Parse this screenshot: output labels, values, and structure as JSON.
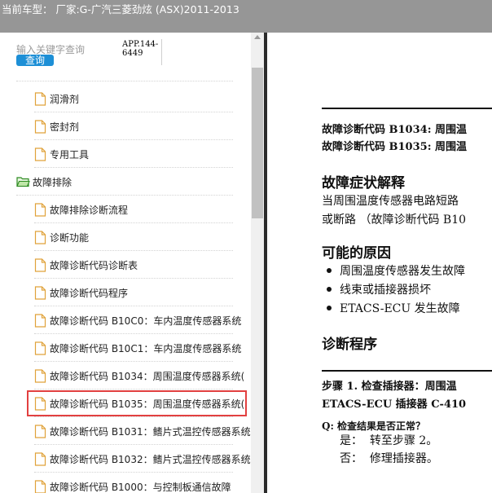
{
  "header": {
    "title": "当前车型： 厂家:G-广汽三菱劲炫 (ASX)2011-2013"
  },
  "search": {
    "placeholder": "输入关键字查询",
    "button_label": "查询",
    "app_code_line1": "APP.144-",
    "app_code_line2": "6449"
  },
  "tree": {
    "items": [
      {
        "label": "润滑剂",
        "icon": "document-icon"
      },
      {
        "label": "密封剂",
        "icon": "document-icon"
      },
      {
        "label": "专用工具",
        "icon": "document-icon"
      },
      {
        "label": "故障排除",
        "icon": "folder-open-icon"
      },
      {
        "label": "故障排除诊断流程",
        "icon": "document-icon"
      },
      {
        "label": "诊断功能",
        "icon": "document-icon"
      },
      {
        "label": "故障诊断代码诊断表",
        "icon": "document-icon"
      },
      {
        "label": "故障诊断代码程序",
        "icon": "document-icon"
      },
      {
        "label": "故障诊断代码 B10C0：车内温度传感器系统",
        "icon": "document-icon"
      },
      {
        "label": "故障诊断代码 B10C1：车内温度传感器系统",
        "icon": "document-icon"
      },
      {
        "label": "故障诊断代码 B1034：周围温度传感器系统(",
        "icon": "document-icon"
      },
      {
        "label": "故障诊断代码 B1035：周围温度传感器系统(",
        "icon": "document-icon",
        "selected": true
      },
      {
        "label": "故障诊断代码 B1031：鳍片式温控传感器系统",
        "icon": "document-icon"
      },
      {
        "label": "故障诊断代码 B1032：鳍片式温控传感器系统",
        "icon": "document-icon"
      },
      {
        "label": "故障诊断代码 B1000：与控制板通信故障",
        "icon": "document-icon"
      }
    ]
  },
  "document": {
    "heading_line1": "故障诊断代码 B1034: 周围温",
    "heading_line2": "故障诊断代码 B1035: 周围温",
    "section1_title": "故障症状解释",
    "section1_text_line1": "当周围温度传感器电路短路",
    "section1_text_line2": "或断路 （故障诊断代码 B10",
    "section2_title": "可能的原因",
    "causes": [
      "周围温度传感器发生故障",
      "线束或插接器损坏",
      "ETACS-ECU 发生故障"
    ],
    "section3_title": "诊断程序",
    "step_line1": "步骤 1. 检查插接器：周围温",
    "step_line2": "ETACS-ECU 插接器 C-410",
    "question": "Q: 检查结果是否正常？",
    "answer_yes_label": "是：",
    "answer_yes_text": "转至步骤 2。",
    "answer_no_label": "否：",
    "answer_no_text": "修理插接器。"
  }
}
